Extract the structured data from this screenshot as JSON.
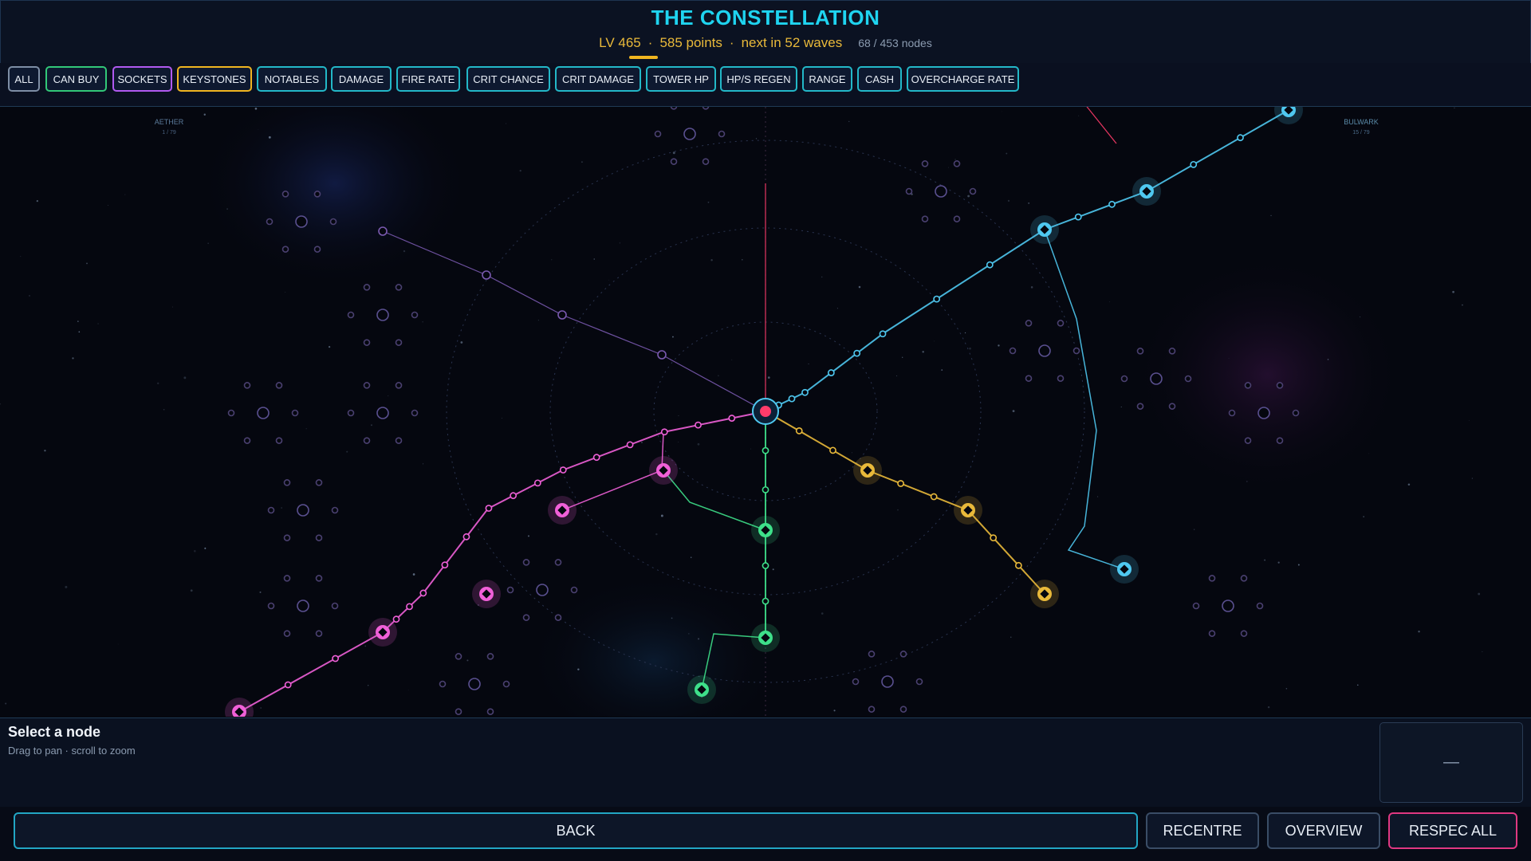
{
  "header": {
    "title": "THE CONSTELLATION",
    "level": "LV 465",
    "points": "585 points",
    "next": "next in 52 waves",
    "nodes": "68 / 453 nodes",
    "sep": "·"
  },
  "filters": [
    "ALL",
    "CAN BUY",
    "SOCKETS",
    "KEYSTONES",
    "NOTABLES",
    "DAMAGE",
    "FIRE RATE",
    "CRIT CHANCE",
    "CRIT DAMAGE",
    "TOWER HP",
    "HP/S REGEN",
    "RANGE",
    "CASH",
    "OVERCHARGE RATE"
  ],
  "map": {
    "region_left": {
      "name": "AETHER",
      "count": "1 / 79"
    },
    "region_right": {
      "name": "BULWARK",
      "count": "15 / 79"
    }
  },
  "info": {
    "title": "Select a node",
    "hint": "Drag to pan · scroll to zoom",
    "slot": "—"
  },
  "actions": {
    "back": "BACK",
    "recentre": "RECENTRE",
    "overview": "OVERVIEW",
    "respec": "RESPEC ALL"
  },
  "colors": {
    "accent": "#1fd4f0",
    "gold": "#e9b93a",
    "pink": "#f060d8",
    "green": "#3ee08a",
    "blue": "#4fc8f0",
    "purple": "#7a5ab0",
    "red": "#ff3c6a"
  }
}
